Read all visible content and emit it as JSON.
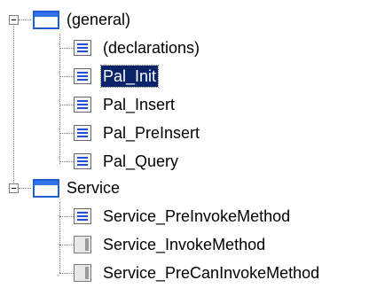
{
  "tree": {
    "groups": [
      {
        "label": "(general)",
        "items": [
          {
            "label": "(declarations)",
            "icon": "procedure-icon"
          },
          {
            "label": "Pal_Init",
            "icon": "procedure-icon",
            "selected": true
          },
          {
            "label": "Pal_Insert",
            "icon": "procedure-icon"
          },
          {
            "label": "Pal_PreInsert",
            "icon": "procedure-icon"
          },
          {
            "label": "Pal_Query",
            "icon": "procedure-icon"
          }
        ]
      },
      {
        "label": "Service",
        "items": [
          {
            "label": "Service_PreInvokeMethod",
            "icon": "procedure-icon"
          },
          {
            "label": "Service_InvokeMethod",
            "icon": "empty-procedure-icon"
          },
          {
            "label": "Service_PreCanInvokeMethod",
            "icon": "empty-procedure-icon"
          }
        ]
      }
    ]
  }
}
